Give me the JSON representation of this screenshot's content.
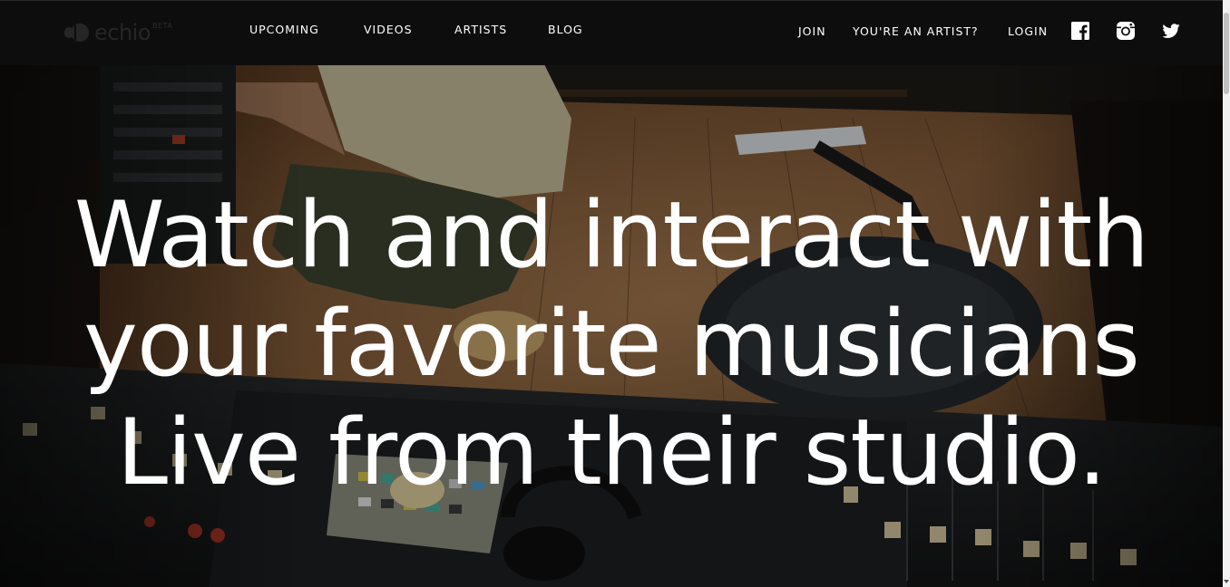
{
  "brand": {
    "name": "echio",
    "badge": "BETA"
  },
  "nav": {
    "items": [
      {
        "label": "UPCOMING"
      },
      {
        "label": "VIDEOS"
      },
      {
        "label": "ARTISTS"
      },
      {
        "label": "BLOG"
      }
    ],
    "account": {
      "join": "JOIN",
      "artist": "YOU'RE AN ARTIST?",
      "login": "LOGIN"
    },
    "social": [
      "facebook-icon",
      "instagram-icon",
      "twitter-icon"
    ]
  },
  "hero": {
    "lines": [
      "Watch and interact with",
      "your favorite musicians",
      "Live from their studio."
    ]
  },
  "colors": {
    "nav_bg": "#0d0d0d",
    "text": "#ffffff",
    "logo": "#262626"
  }
}
